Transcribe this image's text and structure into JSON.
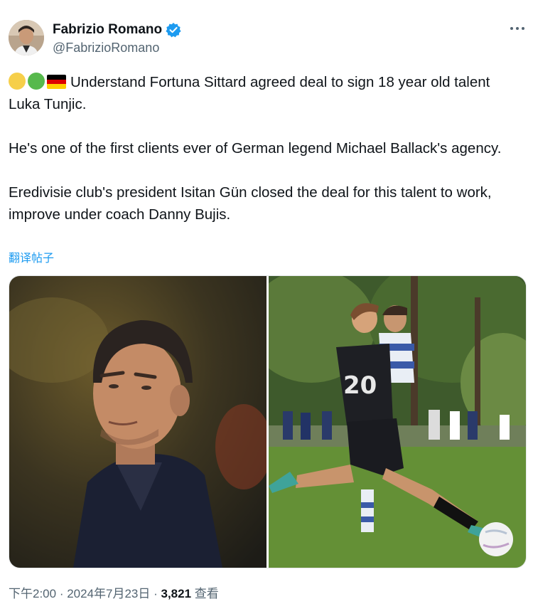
{
  "author": {
    "display_name": "Fabrizio Romano",
    "handle": "@FabrizioRomano",
    "verified": true
  },
  "tweet": {
    "line1_text": "Understand Fortuna Sittard agreed deal to sign 18 year old talent Luka Tunjic.",
    "line2_text": "He's one of the first clients ever of German legend Michael Ballack's agency.",
    "line3_text": "Eredivisie club's president Isitan Gün closed the deal for this talent to work, improve under coach Danny Bujis.",
    "emojis": [
      "yellow-circle",
      "green-circle",
      "germany-flag"
    ],
    "translate_label": "翻译帖子"
  },
  "media": {
    "images": [
      "michael-ballack-portrait",
      "football-match-action"
    ]
  },
  "meta": {
    "time": "下午2:00",
    "separator": " · ",
    "date": "2024年7月23日",
    "separator2": " · ",
    "views_count": "3,821",
    "views_label": " 查看"
  },
  "colors": {
    "accent": "#1d9bf0",
    "text": "#0f1419",
    "secondary": "#536471"
  },
  "icons": {
    "verified": "verified-badge-icon",
    "more": "more-options-icon"
  }
}
